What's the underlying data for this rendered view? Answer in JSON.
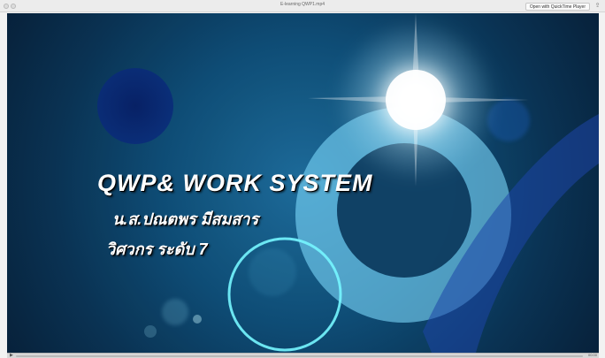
{
  "window": {
    "title": "E-learning QWP1.mp4",
    "open_button": "Open with QuickTime Player",
    "share_icon": "share-icon"
  },
  "video": {
    "title_line": "QWP& WORK SYSTEM",
    "name_line": "น.ส.ปณตพร มีสมสาร",
    "role_line": "วิศวกร ระดับ 7"
  },
  "controls": {
    "play_icon": "play-icon",
    "progress": 0,
    "time": "00:00"
  },
  "colors": {
    "deep_blue": "#0b3557",
    "mid_blue": "#1e6f9f",
    "ring_cyan": "#7fdcff"
  }
}
